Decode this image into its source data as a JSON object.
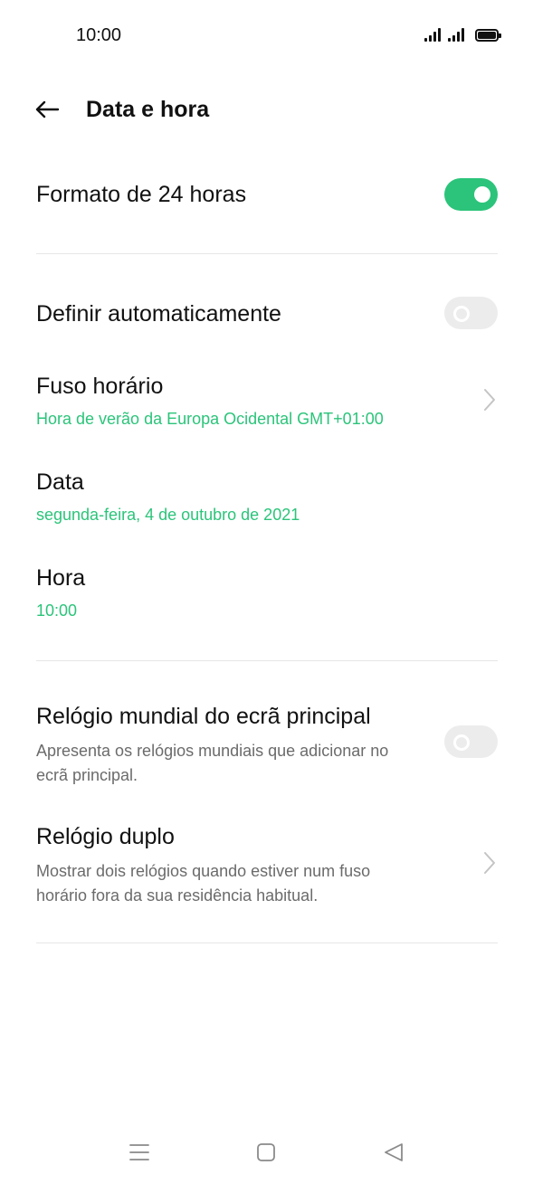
{
  "status_bar": {
    "time": "10:00"
  },
  "header": {
    "title": "Data e hora"
  },
  "settings": {
    "format_24h": {
      "label": "Formato de 24 horas",
      "enabled": true
    },
    "auto_set": {
      "label": "Definir automaticamente",
      "enabled": false
    },
    "timezone": {
      "label": "Fuso horário",
      "value": "Hora de verão da Europa Ocidental GMT+01:00"
    },
    "date": {
      "label": "Data",
      "value": "segunda-feira, 4 de outubro de 2021"
    },
    "time": {
      "label": "Hora",
      "value": "10:00"
    },
    "world_clock": {
      "label": "Relógio mundial do ecrã principal",
      "description": "Apresenta os relógios mundiais que adicionar no ecrã principal.",
      "enabled": false
    },
    "dual_clock": {
      "label": "Relógio duplo",
      "description": "Mostrar dois relógios quando estiver num fuso horário fora da sua residência habitual."
    }
  },
  "colors": {
    "accent": "#2bc47a",
    "toggle_off": "#ececec",
    "text": "#111111",
    "subtext": "#6b6b6b"
  },
  "icons": {
    "back": "arrow-left-icon",
    "chevron": "chevron-right-icon",
    "menu": "menu-icon",
    "home": "home-icon",
    "back_nav": "triangle-back-icon"
  }
}
